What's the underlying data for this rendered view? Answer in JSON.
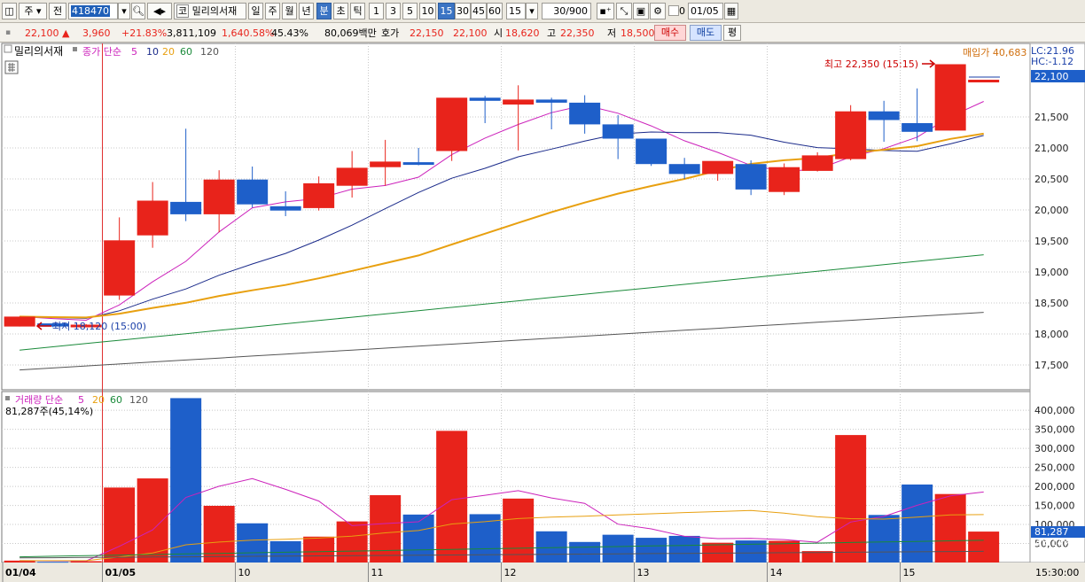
{
  "toolbar": {
    "market": "주",
    "market_all": "전",
    "code": "418470",
    "stock_name": "밀리의서재",
    "exchange": "코",
    "period_day": "일",
    "period_week": "주",
    "period_month": "월",
    "period_year": "년",
    "period_minute": "분",
    "period_second": "초",
    "period_tick": "틱",
    "intervals": [
      "1",
      "3",
      "5",
      "10",
      "15",
      "30",
      "45",
      "60"
    ],
    "active_interval": "15",
    "interval_value": "15",
    "count": "30/900",
    "date": "01/05",
    "checkbox_label": "0"
  },
  "quote": {
    "price": "22,100",
    "change": "3,960",
    "change_pct": "+21.83%",
    "volume": "3,811,109",
    "volume_pct": "1,640.58%",
    "turnover_pct": "45.43%",
    "amount": "80,069백만",
    "ask_label": "호가",
    "ask": "22,150",
    "bid": "22,100",
    "open_label": "시",
    "open": "18,620",
    "high_label": "고",
    "high": "22,350",
    "low_label": "저",
    "low": "18,500",
    "buy_label": "매수",
    "sell_label": "매도",
    "eval_label": "평",
    "up_color": "#e8231b",
    "down_color": "#1e5fc9"
  },
  "legend": {
    "name": "밀리의서재",
    "close_label": "종가 단순",
    "ma_periods": [
      "5",
      "10",
      "20",
      "60",
      "120"
    ],
    "ma_colors": [
      "#cc22bb",
      "#1a2a8a",
      "#e8a010",
      "#1a8a3a",
      "#555555"
    ],
    "volume_label": "거래량 단순",
    "vol_ma_periods": [
      "5",
      "20",
      "60",
      "120"
    ],
    "vol_ma_colors": [
      "#cc22bb",
      "#e8a010",
      "#1a8a3a",
      "#555555"
    ],
    "last_volume": "81,287주(45,14%)"
  },
  "annotations": {
    "high": "최고 22,350 (15:15)",
    "low": "최저 18,120 (15:00)",
    "avg_buy": "매입가 40,683",
    "lc": "LC:21.96",
    "hc": "HC:-1.12",
    "price_tag": "22,100",
    "price_tag_pct": "-1.12%",
    "volume_tag": "81,287",
    "volume_tag_pct": "45.14%",
    "time_end": "15:30:00"
  },
  "chart_data": {
    "type": "candlestick",
    "price_axis": {
      "ylim": [
        17100,
        22700
      ],
      "ticks": [
        17500,
        18000,
        18500,
        19000,
        19500,
        20000,
        20500,
        21000,
        21500
      ]
    },
    "volume_axis": {
      "ylim": [
        0,
        440000
      ],
      "ticks": [
        50000,
        100000,
        150000,
        200000,
        250000,
        300000,
        350000,
        400000
      ]
    },
    "x_labels": [
      "01/04",
      "01/05",
      "10",
      "11",
      "12",
      "13",
      "14",
      "15"
    ],
    "candles": [
      {
        "o": 18120,
        "h": 18280,
        "l": 18120,
        "c": 18280,
        "v": 5000
      },
      {
        "o": 18170,
        "h": 18180,
        "l": 18110,
        "c": 18120,
        "v": 2000
      },
      {
        "o": 18120,
        "h": 18160,
        "l": 18110,
        "c": 18150,
        "v": 3500
      },
      {
        "o": 18620,
        "h": 19880,
        "l": 18550,
        "c": 19510,
        "v": 197000
      },
      {
        "o": 19590,
        "h": 20450,
        "l": 19390,
        "c": 20150,
        "v": 221000
      },
      {
        "o": 20130,
        "h": 21310,
        "l": 19820,
        "c": 19930,
        "v": 432000
      },
      {
        "o": 19930,
        "h": 20640,
        "l": 19640,
        "c": 20490,
        "v": 149000
      },
      {
        "o": 20490,
        "h": 20700,
        "l": 20040,
        "c": 20090,
        "v": 103000
      },
      {
        "o": 20060,
        "h": 20300,
        "l": 19900,
        "c": 19990,
        "v": 56000
      },
      {
        "o": 20030,
        "h": 20540,
        "l": 19990,
        "c": 20430,
        "v": 68000
      },
      {
        "o": 20390,
        "h": 20950,
        "l": 20200,
        "c": 20680,
        "v": 108000
      },
      {
        "o": 20690,
        "h": 21130,
        "l": 20390,
        "c": 20780,
        "v": 177000
      },
      {
        "o": 20770,
        "h": 21000,
        "l": 20720,
        "c": 20760,
        "v": 126000
      },
      {
        "o": 20950,
        "h": 21450,
        "l": 20790,
        "c": 21810,
        "v": 346000
      },
      {
        "o": 21810,
        "h": 21840,
        "l": 21400,
        "c": 21760,
        "v": 127000
      },
      {
        "o": 21700,
        "h": 22010,
        "l": 20960,
        "c": 21780,
        "v": 168000
      },
      {
        "o": 21780,
        "h": 21810,
        "l": 21300,
        "c": 21730,
        "v": 82000
      },
      {
        "o": 21730,
        "h": 21850,
        "l": 21230,
        "c": 21380,
        "v": 54000
      },
      {
        "o": 21380,
        "h": 21530,
        "l": 20820,
        "c": 21150,
        "v": 73000
      },
      {
        "o": 21150,
        "h": 21150,
        "l": 20710,
        "c": 20740,
        "v": 65000
      },
      {
        "o": 20740,
        "h": 20840,
        "l": 20500,
        "c": 20580,
        "v": 70000
      },
      {
        "o": 20580,
        "h": 20780,
        "l": 20470,
        "c": 20790,
        "v": 52000
      },
      {
        "o": 20740,
        "h": 20800,
        "l": 20240,
        "c": 20330,
        "v": 58000
      },
      {
        "o": 20290,
        "h": 20750,
        "l": 20240,
        "c": 20690,
        "v": 57000
      },
      {
        "o": 20630,
        "h": 20930,
        "l": 20620,
        "c": 20880,
        "v": 30000
      },
      {
        "o": 20820,
        "h": 21690,
        "l": 20800,
        "c": 21590,
        "v": 335000
      },
      {
        "o": 21590,
        "h": 21760,
        "l": 21100,
        "c": 21450,
        "v": 125000
      },
      {
        "o": 21400,
        "h": 21960,
        "l": 21110,
        "c": 21260,
        "v": 205000
      },
      {
        "o": 21280,
        "h": 22350,
        "l": 21280,
        "c": 22350,
        "v": 180000
      },
      {
        "o": 22100,
        "h": 22100,
        "l": 22100,
        "c": 22100,
        "v": 81287
      }
    ]
  }
}
